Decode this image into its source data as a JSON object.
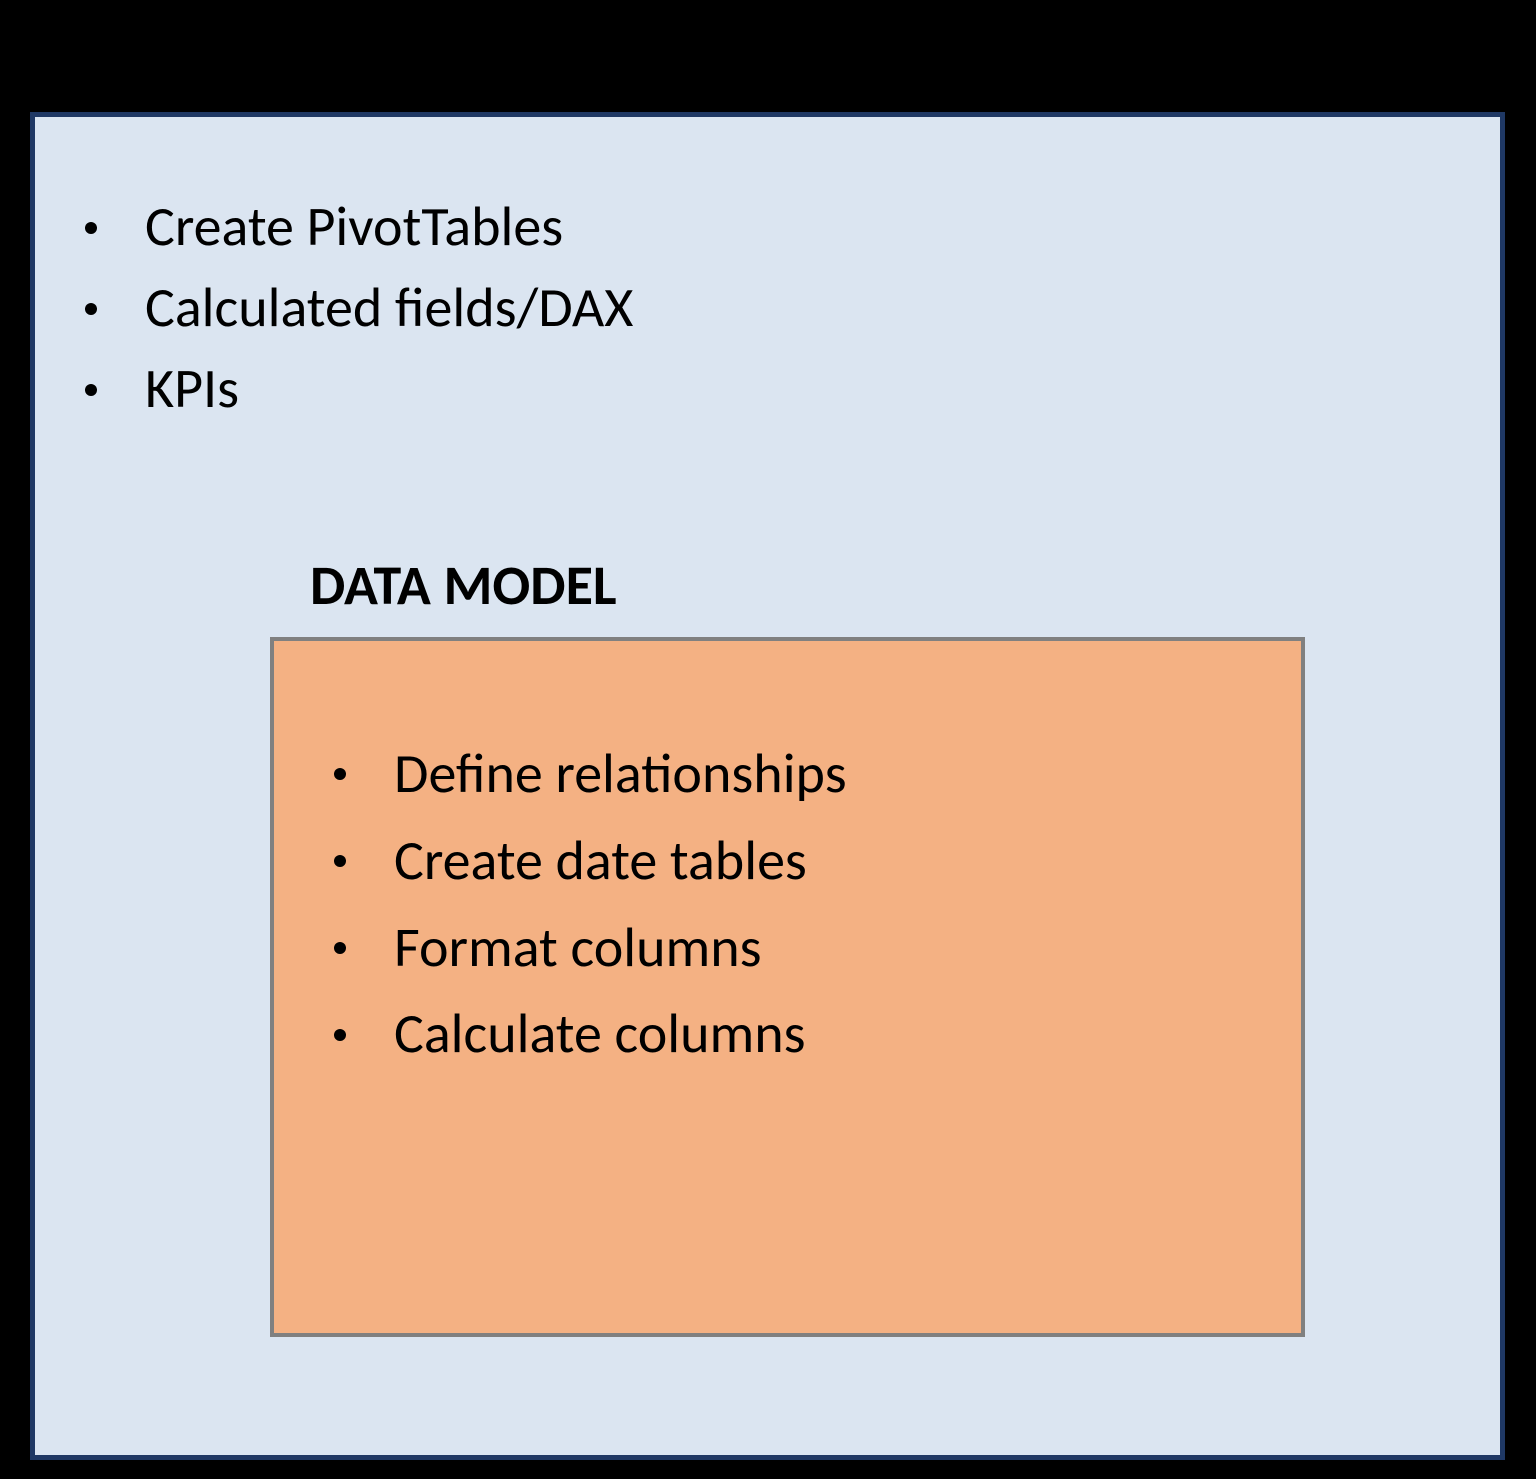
{
  "outer": {
    "items": [
      "Create PivotTables",
      "Calculated fields/DAX",
      "KPIs"
    ]
  },
  "inner": {
    "title": "DATA MODEL",
    "items": [
      "Define relationships",
      "Create date tables",
      "Format columns",
      "Calculate columns"
    ]
  }
}
